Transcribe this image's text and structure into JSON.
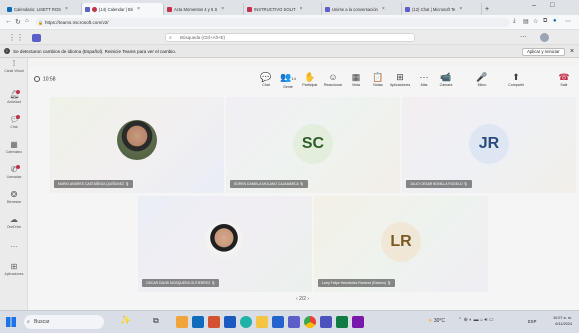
{
  "browser": {
    "tabs": [
      {
        "label": "Calendario: LISETT ROS",
        "color": "#0f6cbd",
        "active": false
      },
      {
        "label": "(14) Calendar | Bri",
        "color": "#5b5fc7",
        "active": true
      },
      {
        "label": "Acta Momentos 4 y 5 S",
        "color": "#c4314b",
        "active": false
      },
      {
        "label": "INSTRUCTIVO SOLIT",
        "color": "#c4314b",
        "active": false
      },
      {
        "label": "Unirse a la conversación",
        "color": "#5b5fc7",
        "active": false
      },
      {
        "label": "(12) Chat | Microsoft Te",
        "color": "#5b5fc7",
        "active": false
      }
    ],
    "new_tab": "+",
    "url": "https://teams.microsoft.com/v2/"
  },
  "teams": {
    "search_placeholder": "Búsqueda (Ctrl+Alt+E)",
    "banner_text": "Se detectaron cambios de idioma (Español). Reinicie Teams para ver el cambio.",
    "banner_button": "Aplicar y reiniciar",
    "banner_close": "×",
    "rail": [
      {
        "label": "Canal Virtual",
        "icon": "dots-icon"
      },
      {
        "label": "Actividad",
        "icon": "bell-icon",
        "badge": true
      },
      {
        "label": "Chat",
        "icon": "chat-icon",
        "badge": true
      },
      {
        "label": "Calendario",
        "icon": "calendar-icon"
      },
      {
        "label": "Llamadas",
        "icon": "phone-icon",
        "badge": true
      },
      {
        "label": "Bienestar",
        "icon": "wellbeing-icon"
      },
      {
        "label": "OneDrive",
        "icon": "onedrive-icon"
      },
      {
        "label": "...",
        "icon": "more-icon"
      },
      {
        "label": "Aplicaciones",
        "icon": "apps-icon"
      }
    ],
    "meeting": {
      "timer": "10:58",
      "toolbar": [
        {
          "label": "Chat",
          "glyph": "💬"
        },
        {
          "label": "Gente",
          "glyph": "👥",
          "count": "14"
        },
        {
          "label": "Participar",
          "glyph": "✋"
        },
        {
          "label": "Reaccionar",
          "glyph": "☺"
        },
        {
          "label": "Vista",
          "glyph": "▦"
        },
        {
          "label": "Notas",
          "glyph": "📋"
        },
        {
          "label": "Aplicaciones",
          "glyph": "⊞"
        },
        {
          "label": "Más",
          "glyph": "⋯"
        },
        {
          "label": "Cámara",
          "glyph": "📹"
        },
        {
          "label": "Micro",
          "glyph": "🎤"
        },
        {
          "label": "Compartir",
          "glyph": "⬆"
        },
        {
          "label": "Salir",
          "glyph": "☎"
        }
      ],
      "participants": [
        {
          "name": "MARIO ANDRES CASTAÑEDA QUIÑONEZ",
          "initials": ""
        },
        {
          "name": "SOREN DANIELA MOLANO CAJAMARCA",
          "initials": "SC"
        },
        {
          "name": "JULIO CESAR BONILLA RODELO",
          "initials": "JR"
        },
        {
          "name": "OSCAR DAVID MOSQUERA GUTIERREZ",
          "initials": ""
        },
        {
          "name": "Larry Felipe Hernández Ramírez (Externo)",
          "initials": "LR"
        }
      ],
      "pagination": "2/2"
    }
  },
  "taskbar": {
    "search": "Buscar",
    "weather": "30°C",
    "lang": "ESP",
    "time": "10:07 a. m.",
    "date": "6/11/2024"
  }
}
